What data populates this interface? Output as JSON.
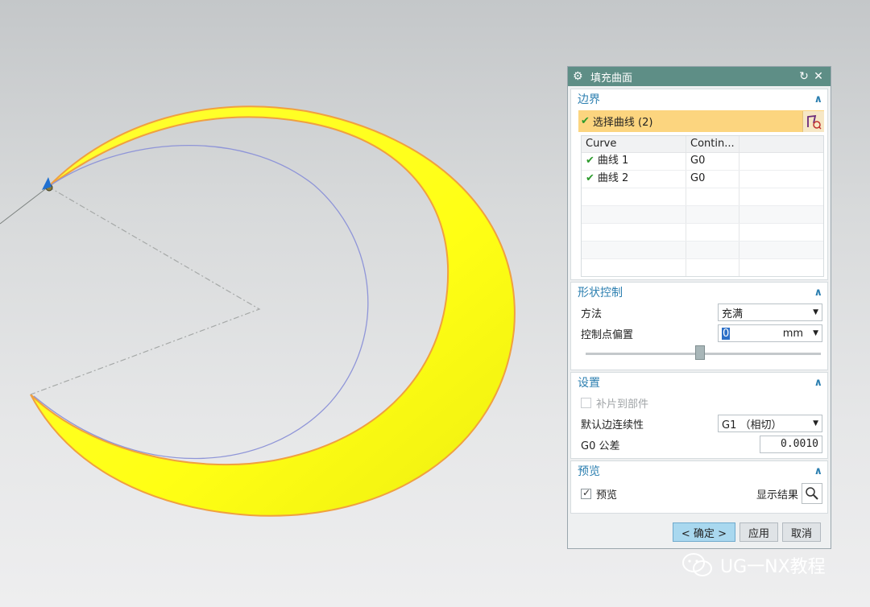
{
  "dialog": {
    "title": "填充曲面",
    "reset_icon": "reset-icon",
    "close_icon": "close-icon",
    "boundary": {
      "header": "边界",
      "select_label": "选择曲线 (2)",
      "columns": [
        "Curve",
        "Contin..."
      ],
      "rows": [
        {
          "curve": "曲线 1",
          "continuity": "G0"
        },
        {
          "curve": "曲线 2",
          "continuity": "G0"
        }
      ]
    },
    "shape_control": {
      "header": "形状控制",
      "method_label": "方法",
      "method_value": "充满",
      "offset_label": "控制点偏置",
      "offset_value": "0",
      "offset_unit": "mm",
      "slider_value": 0.5
    },
    "settings": {
      "header": "设置",
      "patch_label": "补片到部件",
      "continuity_label": "默认边连续性",
      "continuity_value": "G1 （相切）",
      "tolerance_label": "G0 公差",
      "tolerance_value": "0.0010"
    },
    "preview": {
      "header": "预览",
      "preview_label": "预览",
      "show_result_label": "显示结果"
    },
    "buttons": {
      "ok": "< 确定 >",
      "apply": "应用",
      "cancel": "取消"
    }
  },
  "watermark": {
    "text": "UG一NX教程"
  },
  "colors": {
    "surface_fill": "#ffff1a",
    "surface_edge": "#f0a040",
    "curve": "#8f95d8",
    "title_bar": "#5e8e86",
    "section_header": "#2c7fb0",
    "selection_row": "#fcd57f"
  }
}
